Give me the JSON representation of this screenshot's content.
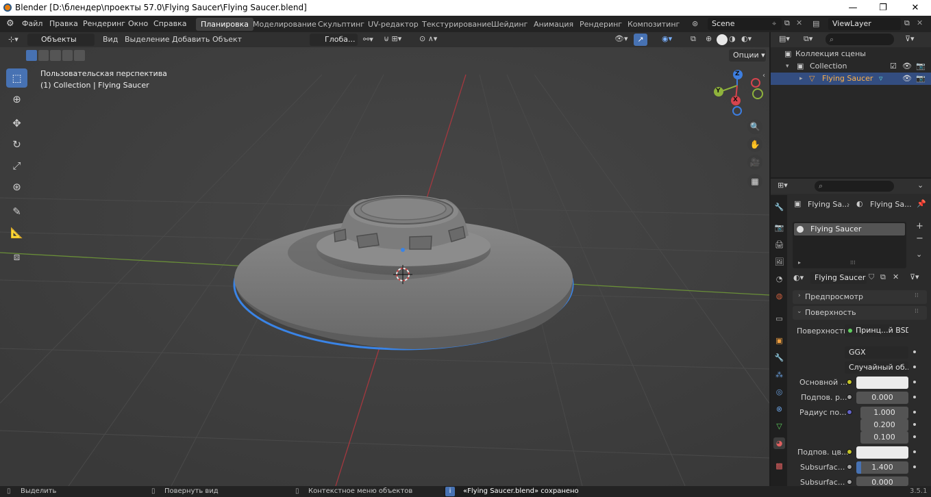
{
  "window": {
    "title": "Blender [D:\\блендер\\проекты 57.0\\Flying Saucer\\Flying Saucer.blend]",
    "minimize": "—",
    "maximize": "❐",
    "close": "✕"
  },
  "menu": [
    "Файл",
    "Правка",
    "Рендеринг",
    "Окно",
    "Справка"
  ],
  "workspaces": [
    "Планировка",
    "Моделирование",
    "Скульптинг",
    "UV-редактор",
    "Текстурирование",
    "Шейдинг",
    "Анимация",
    "Рендеринг",
    "Композитинг"
  ],
  "scene": {
    "name": "Scene",
    "view_layer": "ViewLayer"
  },
  "viewport_header": {
    "mode": "Объекты",
    "menus": [
      "Вид",
      "Выделение",
      "Добавить",
      "Объект"
    ],
    "transform": "Глоба...",
    "options": "Опции"
  },
  "viewport": {
    "view_name": "Пользовательская перспектива",
    "collection_info": "(1) Collection | Flying Saucer",
    "gizmo": {
      "z": "Z",
      "y": "Y",
      "x": "X"
    }
  },
  "outliner": {
    "root": "Коллекция сцены",
    "collection": "Collection",
    "object": "Flying Saucer"
  },
  "properties": {
    "breadcrumb": {
      "object": "Flying Sa...",
      "material": "Flying Sa..."
    },
    "material_slot": "Flying Saucer",
    "material_name": "Flying Saucer",
    "panels": {
      "preview": "Предпросмотр",
      "surface": "Поверхность"
    },
    "surface_label": "Поверхность",
    "surface_shader": "Принц...й BSDF",
    "distribution": "GGX",
    "subsurface_method": "Случайный об...",
    "base_color_label": "Основной ...",
    "subsurface_label": "Подпов. р...",
    "subsurface_value": "0.000",
    "radius_label": "Радиус по...",
    "radius_values": [
      "1.000",
      "0.200",
      "0.100"
    ],
    "ss_color_label": "Подпов. цв...",
    "ss_ior_label": "Subsurfac...",
    "ss_ior_value": "1.400",
    "ss_aniso_label": "Subsurfac...",
    "ss_aniso_value": "0.000"
  },
  "status": {
    "select": "Выделить",
    "rotate": "Повернуть вид",
    "context": "Контекстное меню объектов",
    "message": "«Flying Saucer.blend» сохранено",
    "version": "3.5.1"
  },
  "colors": {
    "accent": "#4772b3",
    "selection_outline": "#3a84e6",
    "x_axis": "#d6444d",
    "y_axis": "#8fb33c",
    "z_axis": "#3d7ee0"
  }
}
